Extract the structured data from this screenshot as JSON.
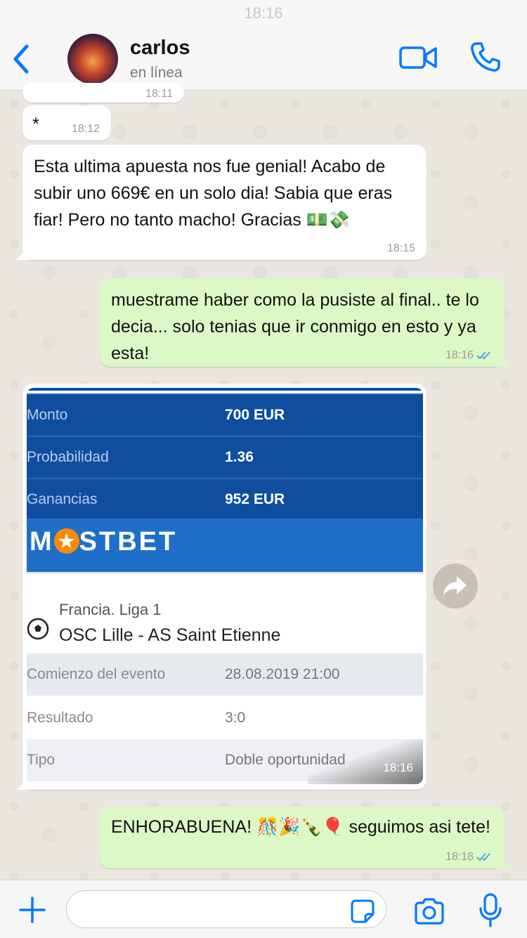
{
  "status_bar": {
    "time": "18:16"
  },
  "header": {
    "contact_name": "carlos",
    "contact_status": "en línea"
  },
  "colors": {
    "accent": "#007aff",
    "incoming_bubble": "#ffffff",
    "outgoing_bubble": "#dcf8c6",
    "read_ticks": "#4fa6e6",
    "bet_panel": "#0f4e9f",
    "brand_bar": "#1f6fc9"
  },
  "messages": [
    {
      "direction": "in",
      "text": "",
      "time": "18:11"
    },
    {
      "direction": "in",
      "text": "*",
      "time": "18:12"
    },
    {
      "direction": "in",
      "text": "Esta ultima apuesta nos fue genial! Acabo de subir uno 669€ en un solo dia! Sabia que eras fiar! Pero no tanto macho! Gracias 💵💸",
      "time": "18:15"
    },
    {
      "direction": "out",
      "text": "muestrame haber como la pusiste al final.. te lo decia... solo tenias que ir conmigo en esto y ya esta!",
      "time": "18:16",
      "status": "read"
    },
    {
      "direction": "in",
      "type": "image",
      "time": "18:16"
    },
    {
      "direction": "out",
      "text": "ENHORABUENA! 🎊🎉🍾🎈  seguimos asi tete!",
      "time": "18:18",
      "status": "read"
    }
  ],
  "bet_slip": {
    "rows": [
      {
        "label": "Monto",
        "value": "700 EUR"
      },
      {
        "label": "Probabilidad",
        "value": "1.36"
      },
      {
        "label": "Ganancias",
        "value": "952 EUR"
      }
    ],
    "brand": {
      "before": "M",
      "after": "STBET"
    },
    "league": "Francia. Liga 1",
    "match": "OSC Lille - AS Saint Etienne",
    "details": [
      {
        "label": "Comienzo del evento",
        "value": "28.08.2019 21:00"
      },
      {
        "label": "Resultado",
        "value": "3:0"
      },
      {
        "label": "Tipo",
        "value": "Doble oportunidad"
      }
    ]
  },
  "composer": {
    "value": "",
    "placeholder": ""
  },
  "icons": {
    "back": "chevron-left-icon",
    "video": "video-camera-icon",
    "phone": "phone-icon",
    "forward": "forward-arrow-icon",
    "plus": "plus-icon",
    "sticker": "sticker-icon",
    "camera": "camera-icon",
    "mic": "microphone-icon"
  }
}
